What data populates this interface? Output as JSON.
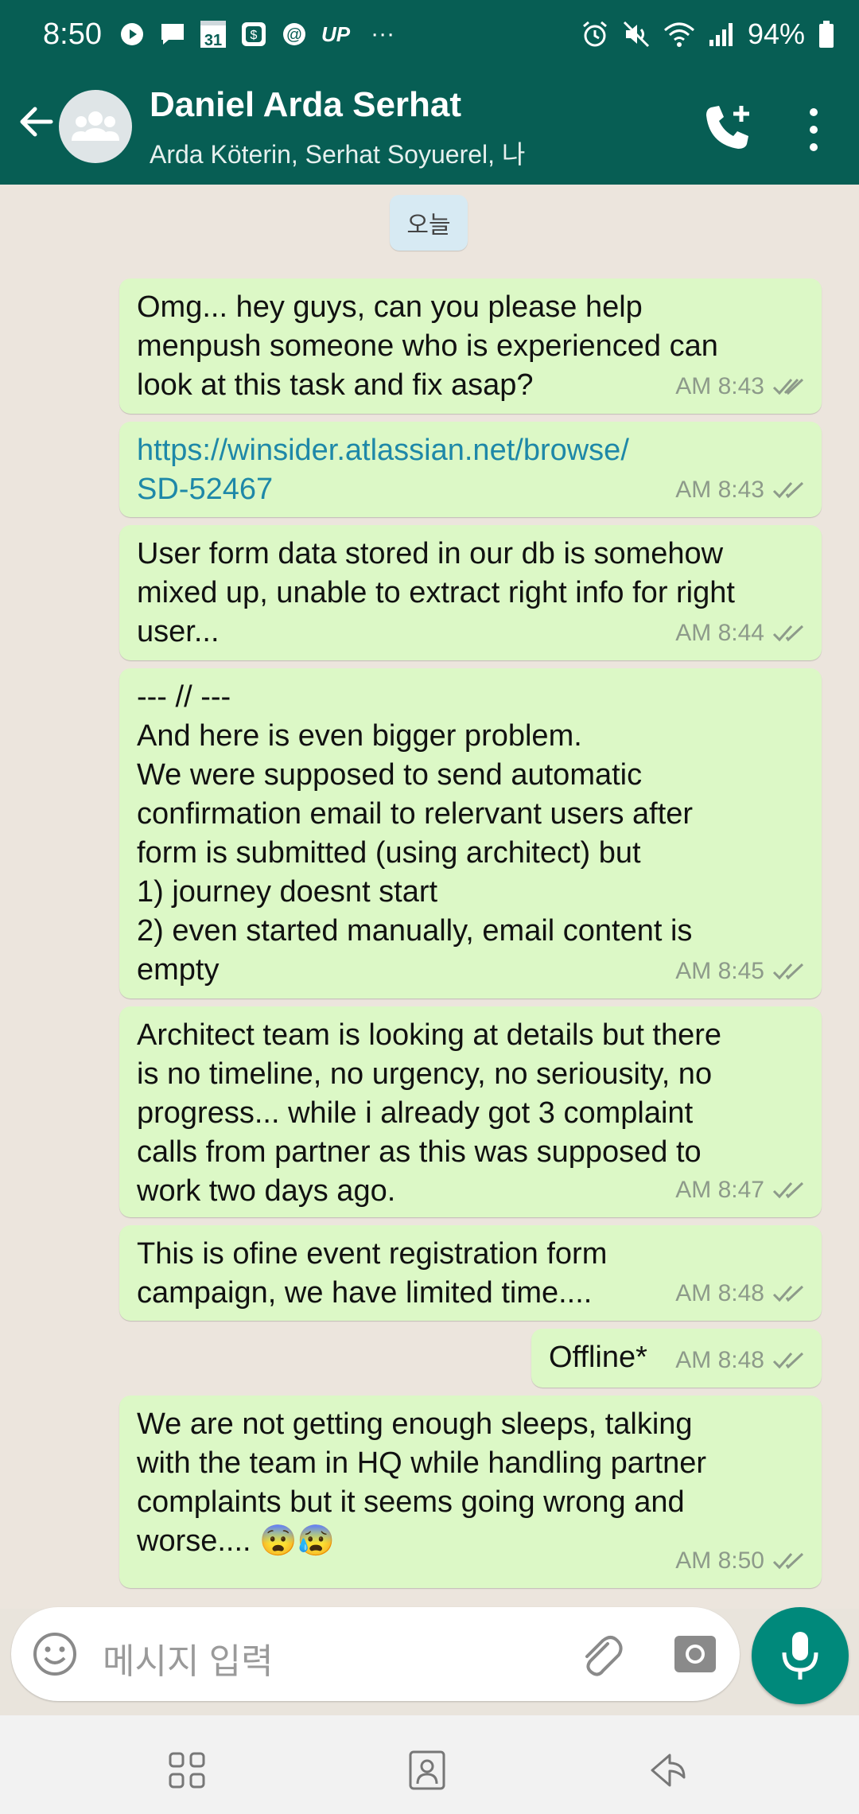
{
  "status_bar": {
    "time": "8:50",
    "calendar_day": "31",
    "up_label": "UP",
    "more": "···",
    "battery": "94%"
  },
  "header": {
    "title": "Daniel Arda Serhat",
    "subtitle": "Arda Köterin, Serhat Soyuerel, 나"
  },
  "chat": {
    "day_label": "오늘",
    "messages": [
      {
        "text": "Omg... hey guys, can you please help\nmenpush someone who is experienced can\nlook at this task and fix asap?",
        "time": "AM 8:43"
      },
      {
        "text": "https://winsider.atlassian.net/browse/\nSD-52467",
        "time": "AM 8:43"
      },
      {
        "text": "User form data stored in our db is somehow\nmixed up, unable to extract right info for right\nuser...",
        "time": "AM 8:44"
      },
      {
        "text": "--- // ---\nAnd here is even bigger problem.\nWe were supposed to send automatic\nconfirmation email to relervant users after\nform is submitted (using architect) but\n1) journey doesnt start\n2) even started manually, email content is\nempty",
        "time": "AM 8:45"
      },
      {
        "text": "Architect team is looking at details but there\nis no timeline, no urgency, no seriousity, no\nprogress... while i already got 3 complaint\ncalls from partner as this was supposed to\nwork two days ago.",
        "time": "AM 8:47"
      },
      {
        "text": "This is ofine event registration form\ncampaign, we have limited time....",
        "time": "AM 8:48"
      },
      {
        "text": "Offline*",
        "time": "AM 8:48"
      },
      {
        "text": "We are not getting enough sleeps, talking\nwith the team in HQ while handling partner\ncomplaints but it seems going wrong and\nworse.... 😨😰",
        "time": "AM 8:50"
      }
    ]
  },
  "input": {
    "placeholder": "메시지 입력"
  },
  "colors": {
    "header": "#075e54",
    "bubble": "#dcf8c6",
    "mic": "#00897b",
    "link": "#1e88a8"
  }
}
